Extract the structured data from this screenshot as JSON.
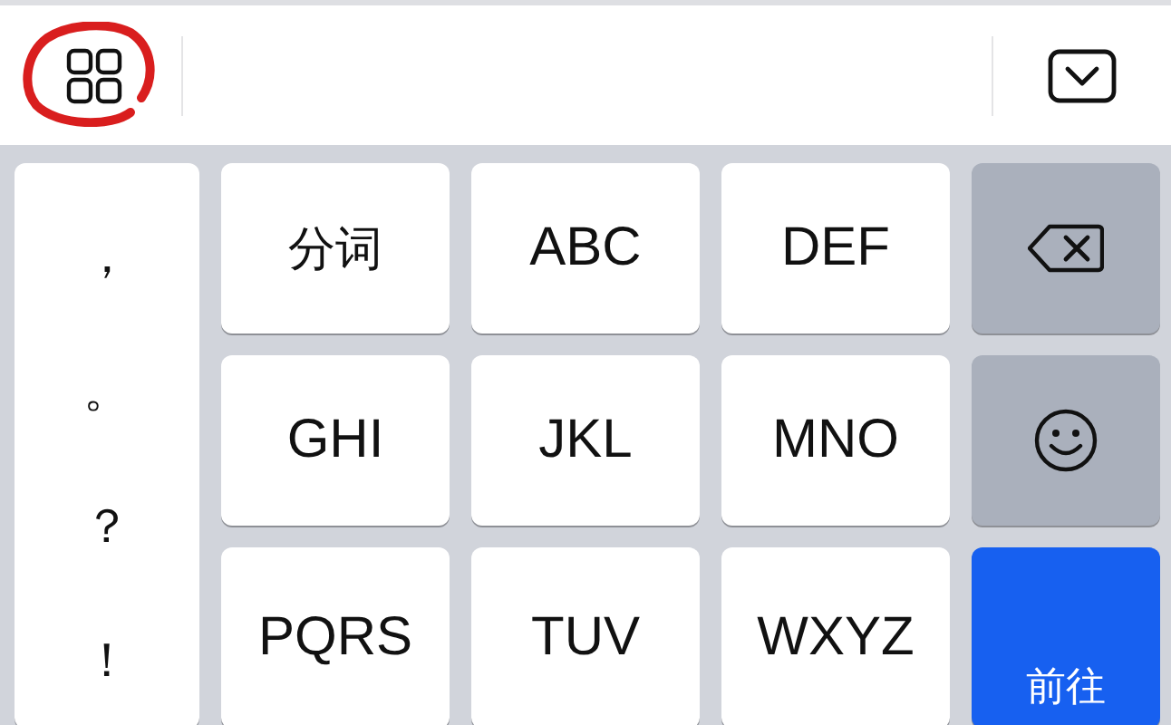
{
  "punctuation": [
    "，",
    "。",
    "？",
    "！"
  ],
  "keys": [
    {
      "kind": "text",
      "label": "分词"
    },
    {
      "kind": "text",
      "label": "ABC"
    },
    {
      "kind": "text",
      "label": "DEF"
    },
    {
      "kind": "delete"
    },
    {
      "kind": "text",
      "label": "GHI"
    },
    {
      "kind": "text",
      "label": "JKL"
    },
    {
      "kind": "text",
      "label": "MNO"
    },
    {
      "kind": "emoji"
    },
    {
      "kind": "text",
      "label": "PQRS"
    },
    {
      "kind": "text",
      "label": "TUV"
    },
    {
      "kind": "text",
      "label": "WXYZ"
    },
    {
      "kind": "enter",
      "label": "前往"
    }
  ]
}
